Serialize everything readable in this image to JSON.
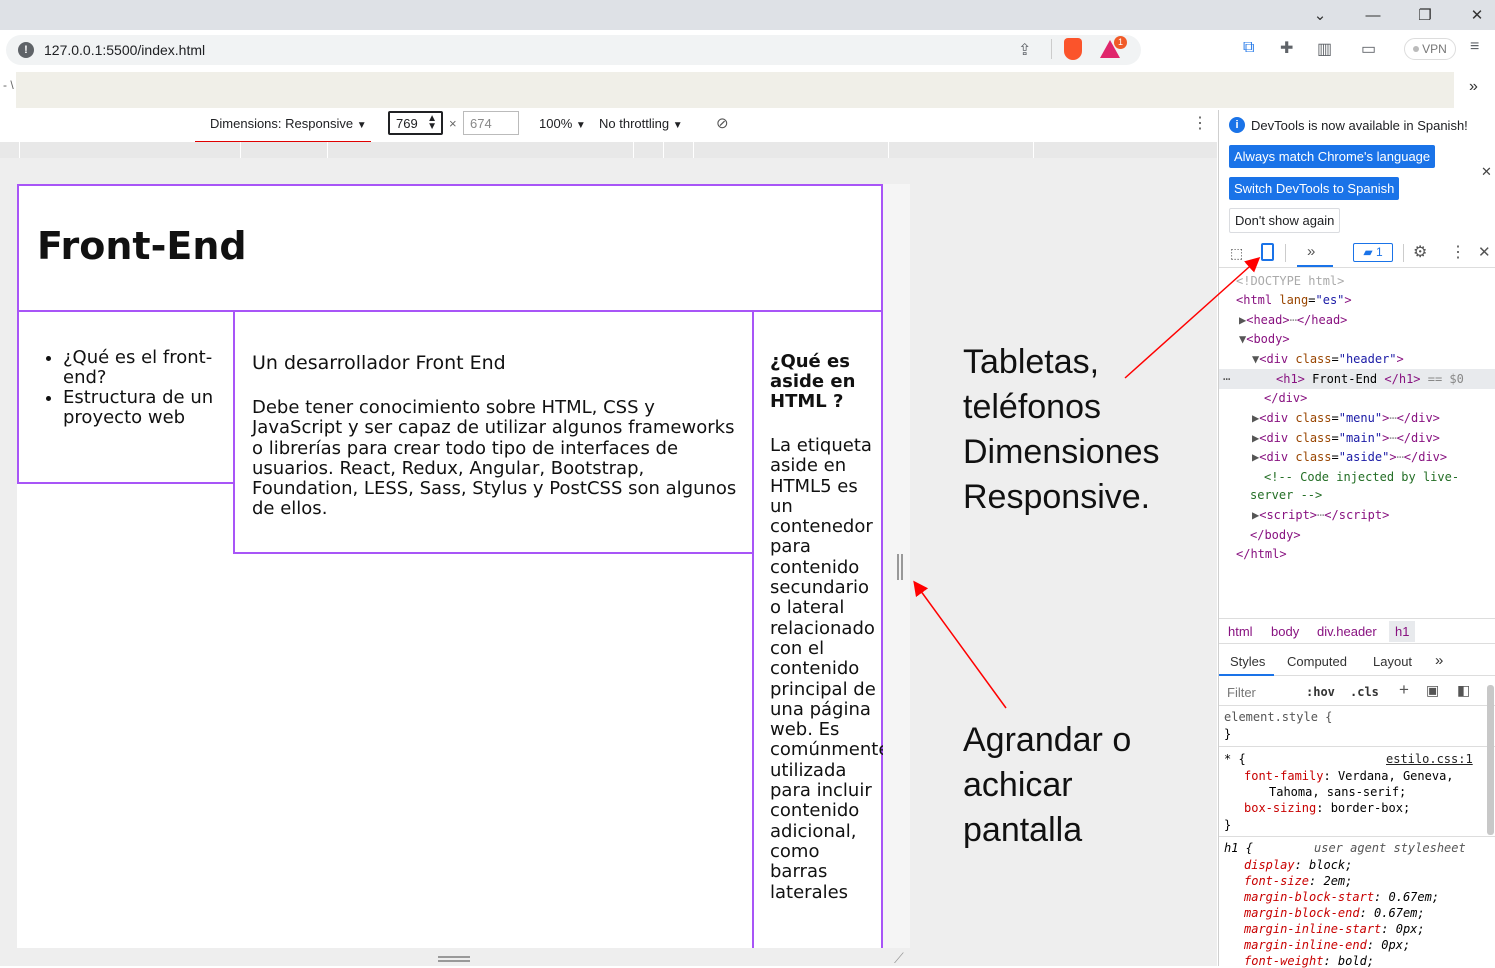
{
  "browser": {
    "url": "127.0.0.1:5500/index.html",
    "vpn_label": "VPN",
    "brave_badge": "1",
    "bookmark_overflow": "»"
  },
  "device_toolbar": {
    "dimensions_label": "Dimensions: Responsive",
    "width_value": "769",
    "height_value": "674",
    "times": "×",
    "zoom": "100%",
    "throttling": "No throttling"
  },
  "page": {
    "header_title": "Front-End",
    "menu_items": [
      "¿Qué es el front-end?",
      "Estructura de un proyecto web"
    ],
    "main_heading": "Un desarrollador Front End",
    "main_text": "Debe tener conocimiento sobre HTML, CSS y JavaScript y ser capaz de utilizar algunos frameworks o librerías para crear todo tipo de interfaces de usuarios. React, Redux, Angular, Bootstrap, Foundation, LESS, Sass, Stylus y PostCSS son algunos de ellos.",
    "aside_heading": "¿Qué es aside en HTML ?",
    "aside_text": "La etiqueta aside en HTML5 es un contenedor para contenido secundario o lateral relacionado con el contenido principal de una página web. Es comúnmente utilizada para incluir contenido adicional, como barras laterales"
  },
  "annotations": {
    "top": [
      "Tabletas,",
      "teléfonos",
      "Dimensiones",
      "Responsive."
    ],
    "bottom": [
      "Agrandar o",
      "achicar",
      "pantalla"
    ],
    "arrow_color": "#ff0000"
  },
  "devtools": {
    "banner_text": "DevTools is now available in Spanish!",
    "btn_match": "Always match Chrome's language",
    "btn_switch": "Switch DevTools to Spanish",
    "btn_dont_show": "Don't show again",
    "issues_count": "1",
    "breadcrumbs": [
      "html",
      "body",
      "div.header",
      "h1"
    ],
    "tabs": [
      "Styles",
      "Computed",
      "Layout"
    ],
    "filter_placeholder": "Filter",
    "hov": ":hov",
    "cls": ".cls",
    "element_style": "element.style {",
    "close_brace": "}",
    "rule1_selector": "* {",
    "rule1_source": "estilo.css:1",
    "rule1_font_prop": "font-family",
    "rule1_font_val": "Verdana, Geneva,",
    "rule1_font_val2": "Tahoma, sans-serif;",
    "rule1_box_prop": "box-sizing",
    "rule1_box_val": "border-box;",
    "rule2_selector": "h1 {",
    "rule2_source": "user agent stylesheet",
    "ua_props": [
      [
        "display",
        "block;"
      ],
      [
        "font-size",
        "2em;"
      ],
      [
        "margin-block-start",
        "0.67em;"
      ],
      [
        "margin-block-end",
        "0.67em;"
      ],
      [
        "margin-inline-start",
        "0px;"
      ],
      [
        "margin-inline-end",
        "0px;"
      ],
      [
        "font-weight",
        "bold;"
      ]
    ]
  }
}
